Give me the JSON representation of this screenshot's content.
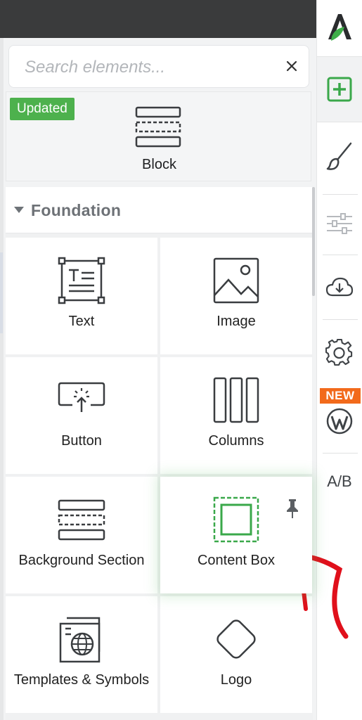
{
  "search": {
    "placeholder": "Search elements...",
    "value": ""
  },
  "block_card": {
    "badge": "Updated",
    "label": "Block"
  },
  "section": {
    "title": "Foundation"
  },
  "elements": [
    {
      "label": "Text",
      "icon": "text-icon"
    },
    {
      "label": "Image",
      "icon": "image-icon"
    },
    {
      "label": "Button",
      "icon": "button-icon"
    },
    {
      "label": "Columns",
      "icon": "columns-icon"
    },
    {
      "label": "Background Section",
      "icon": "background-section-icon"
    },
    {
      "label": "Content Box",
      "icon": "content-box-icon"
    },
    {
      "label": "Templates & Symbols",
      "icon": "templates-symbols-icon"
    },
    {
      "label": "Logo",
      "icon": "logo-icon"
    }
  ],
  "sidebar": {
    "items": [
      {
        "icon": "app-logo-icon"
      },
      {
        "icon": "add-element-icon",
        "active": true
      },
      {
        "icon": "brush-icon"
      },
      {
        "icon": "sliders-icon"
      },
      {
        "icon": "cloud-download-icon"
      },
      {
        "icon": "gear-icon"
      },
      {
        "icon": "wordpress-icon",
        "badge": "NEW"
      },
      {
        "icon": "ab-test-icon",
        "label": "A/B"
      }
    ]
  },
  "colors": {
    "accent_green": "#4db14d",
    "new_badge": "#f26a1b",
    "arrow_red": "#e0101b"
  }
}
